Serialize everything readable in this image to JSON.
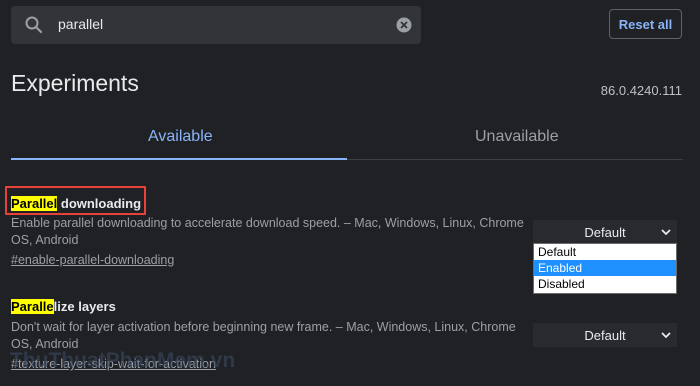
{
  "search": {
    "value": "parallel"
  },
  "toolbar": {
    "reset_label": "Reset all"
  },
  "header": {
    "title": "Experiments",
    "version": "86.0.4240.111"
  },
  "tabs": [
    {
      "label": "Available",
      "active": true
    },
    {
      "label": "Unavailable",
      "active": false
    }
  ],
  "experiments": [
    {
      "name_highlight": "Parallel",
      "name_rest": " downloading",
      "description": "Enable parallel downloading to accelerate download speed. – Mac, Windows, Linux, Chrome OS, Android",
      "link": "#enable-parallel-downloading",
      "select_value": "Default",
      "options": [
        "Default",
        "Enabled",
        "Disabled"
      ],
      "highlighted_option": "Enabled"
    },
    {
      "name_highlight": "Paralle",
      "name_rest": "lize layers",
      "description": "Don't wait for layer activation before beginning new frame. – Mac, Windows, Linux, Chrome OS, Android",
      "link": "#texture-layer-skip-wait-for-activation",
      "select_value": "Default"
    }
  ],
  "watermark": "ThuThuatPhanMem.vn",
  "colors": {
    "accent": "#8ab4f8",
    "highlight": "#ffff00",
    "annotation": "#e8413a",
    "background": "#202124"
  }
}
